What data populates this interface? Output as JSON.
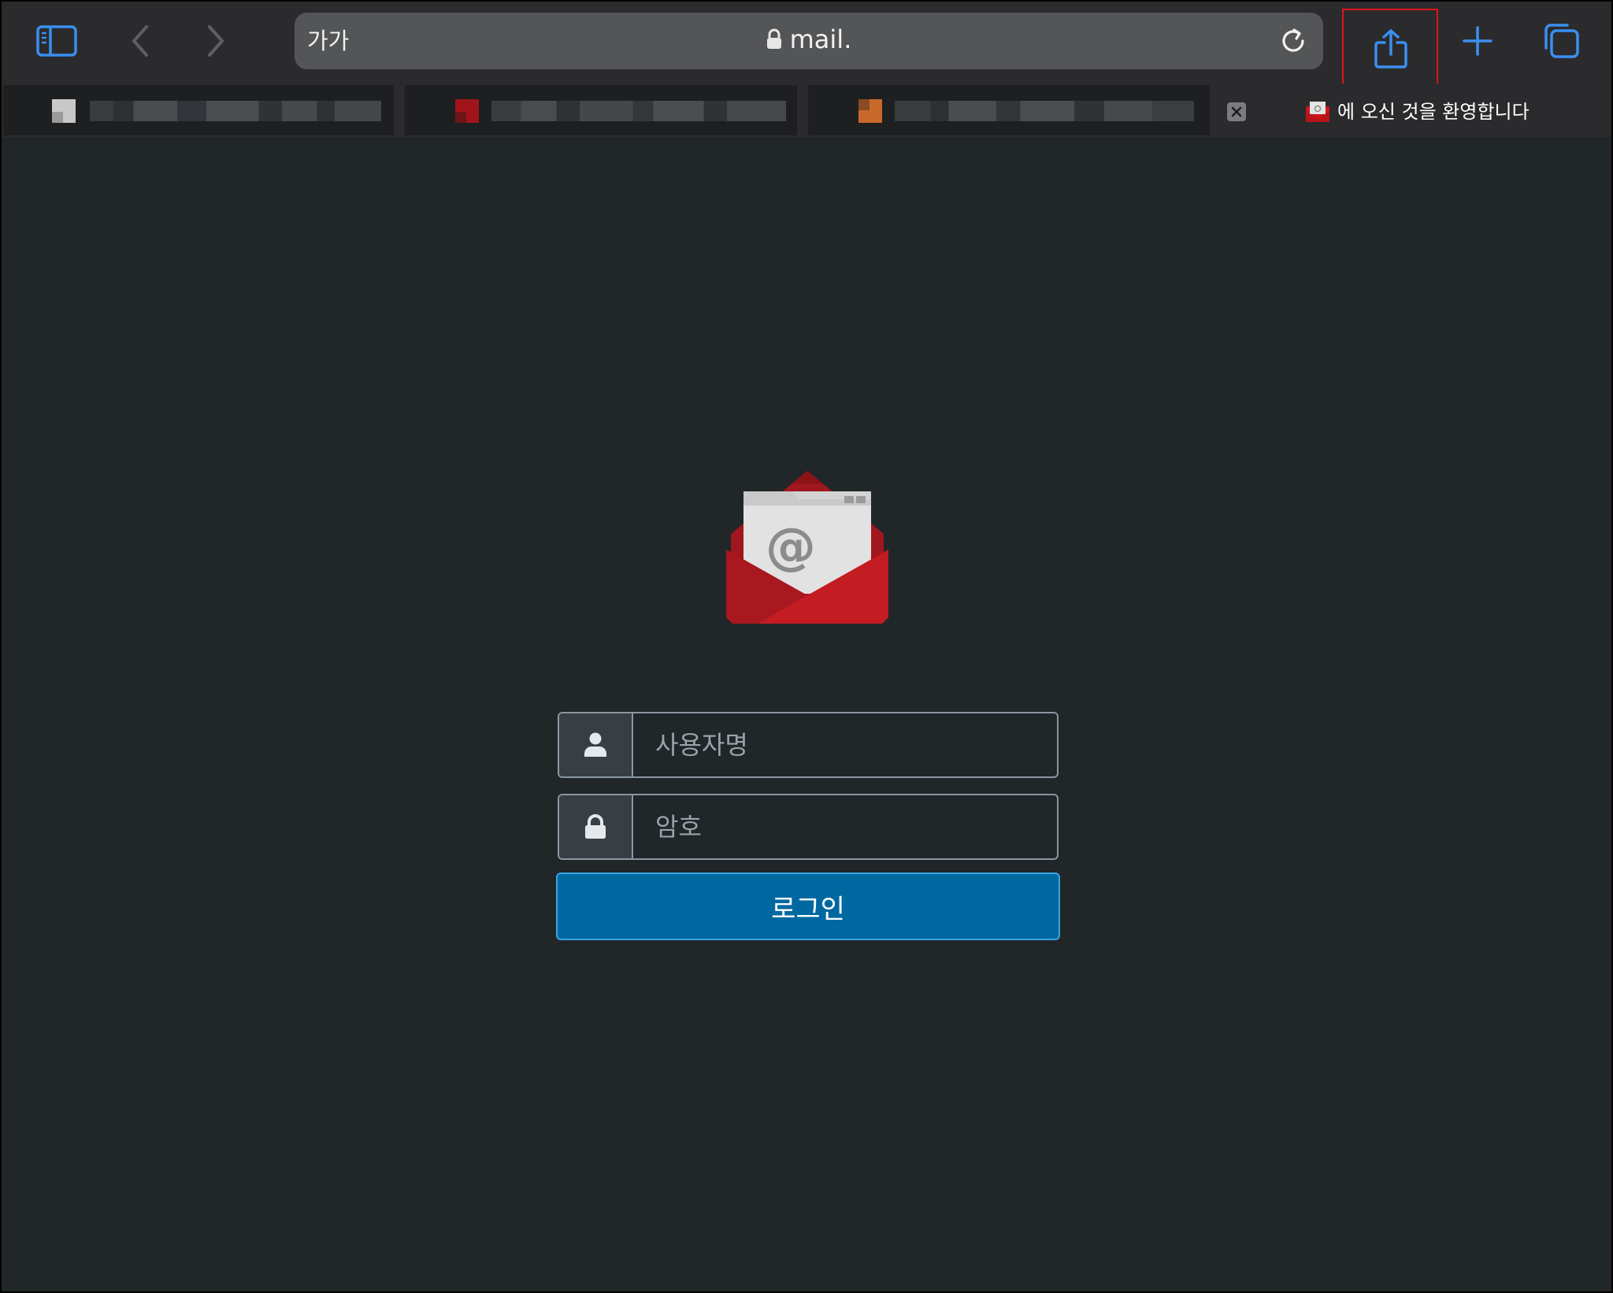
{
  "browser": {
    "reader_label": "가가",
    "url": "mail.",
    "accent_color": "#3b8ff0",
    "highlight_color": "#e0141b"
  },
  "tabs": [
    {
      "title": "",
      "redacted": true
    },
    {
      "title": "",
      "redacted": true
    },
    {
      "title": "",
      "redacted": true
    },
    {
      "title": "에 오신 것을 환영합니다",
      "active": true
    }
  ],
  "login": {
    "username_placeholder": "사용자명",
    "password_placeholder": "암호",
    "login_button_label": "로그인",
    "button_color": "#0068a1"
  },
  "icons": {
    "sidebar": "sidebar-icon",
    "back": "chevron-left-icon",
    "forward": "chevron-right-icon",
    "lock": "lock-icon",
    "reload": "reload-icon",
    "share": "share-icon",
    "new_tab": "plus-icon",
    "tab_overview": "tabs-icon",
    "close_tab": "close-icon",
    "user": "user-icon",
    "password": "lock-icon",
    "logo": "mail-envelope-icon"
  }
}
